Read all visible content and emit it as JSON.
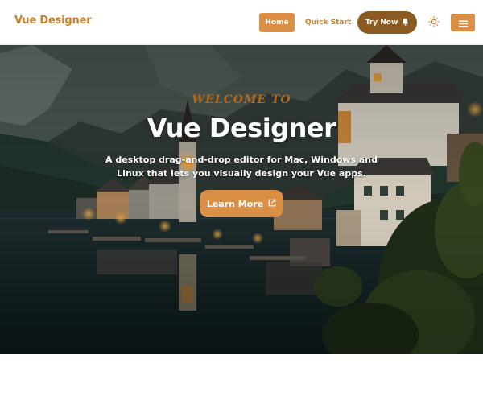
{
  "header": {
    "brand": "Vue Designer",
    "nav": {
      "home_label": "Home",
      "quick_start_label": "Quick Start",
      "try_now_label": "Try Now",
      "try_now_icon": "bell-icon",
      "theme_icon": "sun-icon",
      "menu_icon": "hamburger-menu-icon"
    }
  },
  "hero": {
    "welcome": "WELCOME TO",
    "title": "Vue Designer",
    "description": "A desktop drag-and-drop editor for Mac, Windows and Linux that lets you visually design your Vue apps.",
    "cta_label": "Learn More",
    "cta_icon": "external-link-icon",
    "background": "lakeside village at dusk with mountains and church tower"
  },
  "colors": {
    "accent": "#d98f45",
    "brand": "#cd7f26",
    "try_now_bg": "#8a5a22"
  }
}
